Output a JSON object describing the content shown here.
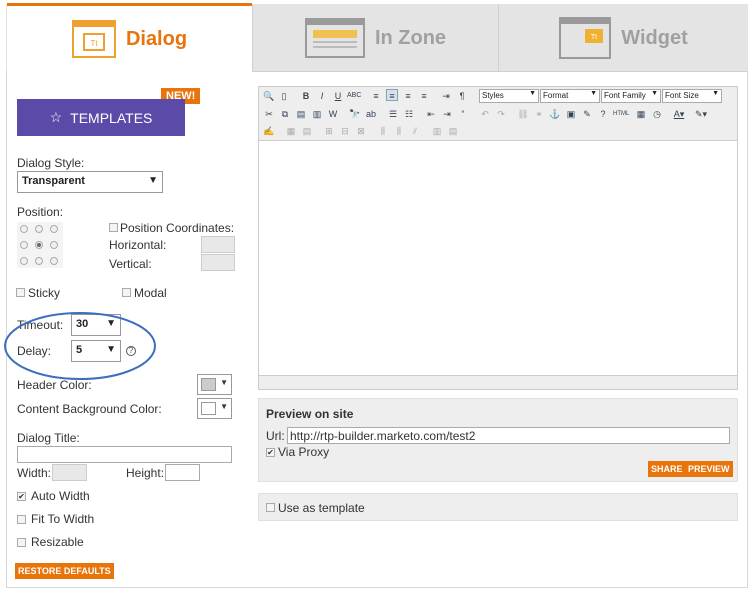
{
  "tabs": [
    {
      "label": "Dialog",
      "icon": "dialog-window-icon",
      "active": true
    },
    {
      "label": "In Zone",
      "icon": "inzone-window-icon",
      "active": false
    },
    {
      "label": "Widget",
      "icon": "widget-window-icon",
      "active": false
    }
  ],
  "templates": {
    "label": "TEMPLATES",
    "badge": "NEW!"
  },
  "dialog_style": {
    "label": "Dialog Style:",
    "value": "Transparent"
  },
  "position": {
    "label": "Position:",
    "coords_label": "Position Coordinates:",
    "horizontal": "Horizontal:",
    "vertical": "Vertical:"
  },
  "sticky": "Sticky",
  "modal": "Modal",
  "timeout": {
    "label": "Timeout:",
    "value": "30"
  },
  "delay": {
    "label": "Delay:",
    "value": "5"
  },
  "header_color": "Header Color:",
  "content_bg_color": "Content Background Color:",
  "dialog_title": "Dialog Title:",
  "width": "Width:",
  "height": "Height:",
  "auto_width": "Auto Width",
  "fit_to_width": "Fit To Width",
  "resizable": "Resizable",
  "restore_defaults": "RESTORE DEFAULTS",
  "editor": {
    "styles": "Styles",
    "format": "Format",
    "font_family": "Font Family",
    "font_size": "Font Size"
  },
  "preview": {
    "title": "Preview on site",
    "url_label": "Url:",
    "url_value": "http://rtp-builder.marketo.com/test2",
    "via_proxy": "Via Proxy",
    "share": "SHARE",
    "preview": "PREVIEW"
  },
  "use_as_template": "Use as template",
  "colors": {
    "accent": "#e8740c",
    "templates_bg": "#5b4aa7",
    "circle": "#3c6fbf"
  }
}
